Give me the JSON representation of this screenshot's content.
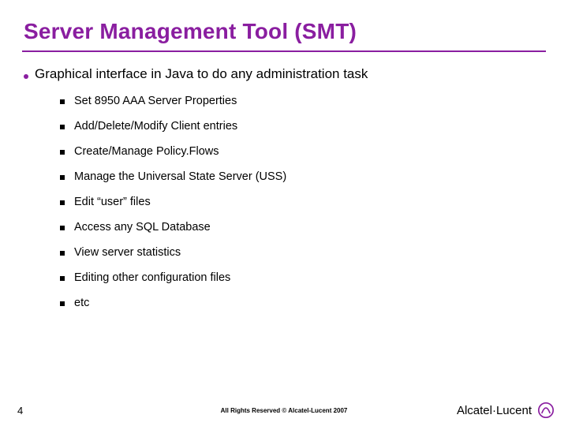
{
  "title": "Server Management Tool (SMT)",
  "intro": "Graphical interface in Java to do any administration task",
  "subpoints": [
    "Set 8950 AAA Server Properties",
    "Add/Delete/Modify Client entries",
    "Create/Manage Policy.Flows",
    "Manage the Universal State Server (USS)",
    "Edit “user” files",
    "Access any SQL Database",
    "View server statistics",
    "Editing other configuration files",
    "etc"
  ],
  "footer": {
    "page": "4",
    "copyright": "All Rights Reserved © Alcatel-Lucent 2007",
    "brand": "Alcatel·Lucent"
  },
  "colors": {
    "accent": "#8a1ea0"
  }
}
